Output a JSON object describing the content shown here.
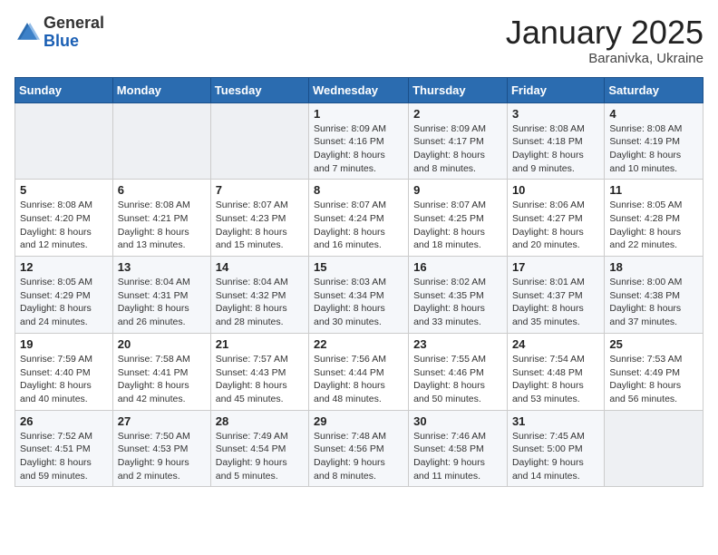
{
  "header": {
    "logo_general": "General",
    "logo_blue": "Blue",
    "title": "January 2025",
    "subtitle": "Baranivka, Ukraine"
  },
  "days_of_week": [
    "Sunday",
    "Monday",
    "Tuesday",
    "Wednesday",
    "Thursday",
    "Friday",
    "Saturday"
  ],
  "weeks": [
    [
      {
        "day": "",
        "info": ""
      },
      {
        "day": "",
        "info": ""
      },
      {
        "day": "",
        "info": ""
      },
      {
        "day": "1",
        "info": "Sunrise: 8:09 AM\nSunset: 4:16 PM\nDaylight: 8 hours and 7 minutes."
      },
      {
        "day": "2",
        "info": "Sunrise: 8:09 AM\nSunset: 4:17 PM\nDaylight: 8 hours and 8 minutes."
      },
      {
        "day": "3",
        "info": "Sunrise: 8:08 AM\nSunset: 4:18 PM\nDaylight: 8 hours and 9 minutes."
      },
      {
        "day": "4",
        "info": "Sunrise: 8:08 AM\nSunset: 4:19 PM\nDaylight: 8 hours and 10 minutes."
      }
    ],
    [
      {
        "day": "5",
        "info": "Sunrise: 8:08 AM\nSunset: 4:20 PM\nDaylight: 8 hours and 12 minutes."
      },
      {
        "day": "6",
        "info": "Sunrise: 8:08 AM\nSunset: 4:21 PM\nDaylight: 8 hours and 13 minutes."
      },
      {
        "day": "7",
        "info": "Sunrise: 8:07 AM\nSunset: 4:23 PM\nDaylight: 8 hours and 15 minutes."
      },
      {
        "day": "8",
        "info": "Sunrise: 8:07 AM\nSunset: 4:24 PM\nDaylight: 8 hours and 16 minutes."
      },
      {
        "day": "9",
        "info": "Sunrise: 8:07 AM\nSunset: 4:25 PM\nDaylight: 8 hours and 18 minutes."
      },
      {
        "day": "10",
        "info": "Sunrise: 8:06 AM\nSunset: 4:27 PM\nDaylight: 8 hours and 20 minutes."
      },
      {
        "day": "11",
        "info": "Sunrise: 8:05 AM\nSunset: 4:28 PM\nDaylight: 8 hours and 22 minutes."
      }
    ],
    [
      {
        "day": "12",
        "info": "Sunrise: 8:05 AM\nSunset: 4:29 PM\nDaylight: 8 hours and 24 minutes."
      },
      {
        "day": "13",
        "info": "Sunrise: 8:04 AM\nSunset: 4:31 PM\nDaylight: 8 hours and 26 minutes."
      },
      {
        "day": "14",
        "info": "Sunrise: 8:04 AM\nSunset: 4:32 PM\nDaylight: 8 hours and 28 minutes."
      },
      {
        "day": "15",
        "info": "Sunrise: 8:03 AM\nSunset: 4:34 PM\nDaylight: 8 hours and 30 minutes."
      },
      {
        "day": "16",
        "info": "Sunrise: 8:02 AM\nSunset: 4:35 PM\nDaylight: 8 hours and 33 minutes."
      },
      {
        "day": "17",
        "info": "Sunrise: 8:01 AM\nSunset: 4:37 PM\nDaylight: 8 hours and 35 minutes."
      },
      {
        "day": "18",
        "info": "Sunrise: 8:00 AM\nSunset: 4:38 PM\nDaylight: 8 hours and 37 minutes."
      }
    ],
    [
      {
        "day": "19",
        "info": "Sunrise: 7:59 AM\nSunset: 4:40 PM\nDaylight: 8 hours and 40 minutes."
      },
      {
        "day": "20",
        "info": "Sunrise: 7:58 AM\nSunset: 4:41 PM\nDaylight: 8 hours and 42 minutes."
      },
      {
        "day": "21",
        "info": "Sunrise: 7:57 AM\nSunset: 4:43 PM\nDaylight: 8 hours and 45 minutes."
      },
      {
        "day": "22",
        "info": "Sunrise: 7:56 AM\nSunset: 4:44 PM\nDaylight: 8 hours and 48 minutes."
      },
      {
        "day": "23",
        "info": "Sunrise: 7:55 AM\nSunset: 4:46 PM\nDaylight: 8 hours and 50 minutes."
      },
      {
        "day": "24",
        "info": "Sunrise: 7:54 AM\nSunset: 4:48 PM\nDaylight: 8 hours and 53 minutes."
      },
      {
        "day": "25",
        "info": "Sunrise: 7:53 AM\nSunset: 4:49 PM\nDaylight: 8 hours and 56 minutes."
      }
    ],
    [
      {
        "day": "26",
        "info": "Sunrise: 7:52 AM\nSunset: 4:51 PM\nDaylight: 8 hours and 59 minutes."
      },
      {
        "day": "27",
        "info": "Sunrise: 7:50 AM\nSunset: 4:53 PM\nDaylight: 9 hours and 2 minutes."
      },
      {
        "day": "28",
        "info": "Sunrise: 7:49 AM\nSunset: 4:54 PM\nDaylight: 9 hours and 5 minutes."
      },
      {
        "day": "29",
        "info": "Sunrise: 7:48 AM\nSunset: 4:56 PM\nDaylight: 9 hours and 8 minutes."
      },
      {
        "day": "30",
        "info": "Sunrise: 7:46 AM\nSunset: 4:58 PM\nDaylight: 9 hours and 11 minutes."
      },
      {
        "day": "31",
        "info": "Sunrise: 7:45 AM\nSunset: 5:00 PM\nDaylight: 9 hours and 14 minutes."
      },
      {
        "day": "",
        "info": ""
      }
    ]
  ]
}
